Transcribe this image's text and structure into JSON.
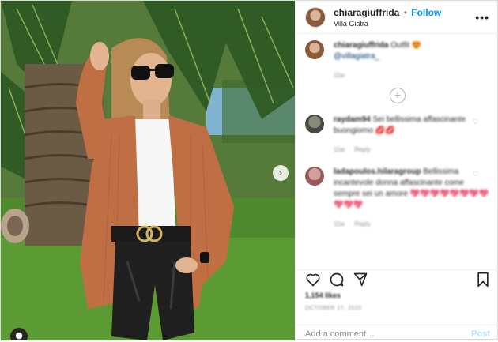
{
  "post": {
    "username": "chiaragiuffrida",
    "separator": "•",
    "follow_label": "Follow",
    "location": "Villa Giatra",
    "more_label": "•••"
  },
  "caption": {
    "username": "chiaragiuffrida",
    "text": "Outfit 😍",
    "mention": "@villagiatra_",
    "meta": "11w"
  },
  "comments": [
    {
      "username": "raydam94",
      "text": "Sei bellissima affascinante buongiorno 💋💋",
      "meta": "11w",
      "reply_label": "Reply"
    },
    {
      "username": "ladapoulos.hilaragroup",
      "text": "Bellissima incantevole donna affascinante come sempre sei un amore 💖💖💖💖💖💖💖💖💖💖💖",
      "meta": "11w",
      "reply_label": "Reply"
    }
  ],
  "icons": {
    "heart": "heart-icon",
    "comment": "comment-icon",
    "share": "share-icon",
    "save": "bookmark-icon",
    "next": "chevron-right-icon",
    "load_more": "plus-circle-icon",
    "tag": "user-tag-icon"
  },
  "stats": {
    "likes": "1,154 likes",
    "date": "OCTOBER 27, 2020"
  },
  "add_comment": {
    "placeholder": "Add a comment…",
    "post_label": "Post"
  },
  "colors": {
    "accent": "#0095f6",
    "post_disabled": "#b2dffc",
    "muted": "#8e8e8e"
  }
}
